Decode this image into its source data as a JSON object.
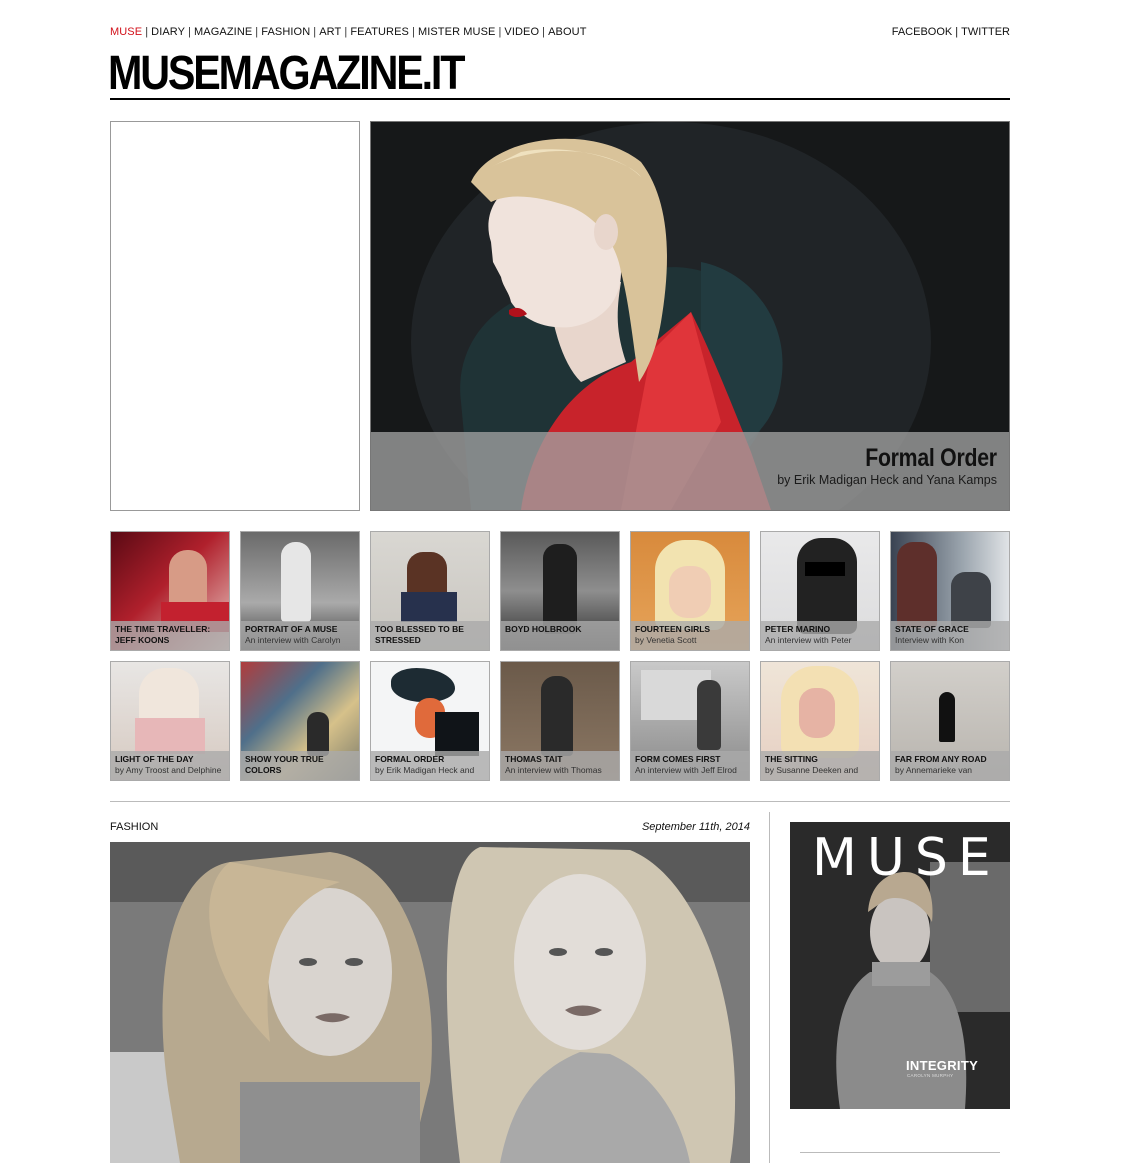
{
  "nav": {
    "items": [
      {
        "label": "MUSE",
        "active": true
      },
      {
        "label": "DIARY",
        "active": false
      },
      {
        "label": "MAGAZINE",
        "active": false
      },
      {
        "label": "FASHION",
        "active": false
      },
      {
        "label": "ART",
        "active": false
      },
      {
        "label": "FEATURES",
        "active": false
      },
      {
        "label": "MISTER MUSE",
        "active": false
      },
      {
        "label": "VIDEO",
        "active": false
      },
      {
        "label": "ABOUT",
        "active": false
      }
    ],
    "separator": "|"
  },
  "social": {
    "facebook": "FACEBOOK",
    "twitter": "TWITTER",
    "separator": "|"
  },
  "logo": "MUSEMAGAZINE.IT",
  "hero": {
    "title": "Formal Order",
    "subtitle": "by Erik Madigan Heck and Yana Kamps"
  },
  "thumbs": [
    {
      "title": "THE TIME TRAVELLER:\nJEFF KOONS",
      "subtitle": ""
    },
    {
      "title": "PORTRAIT OF A MUSE",
      "subtitle": "An interview with Carolyn"
    },
    {
      "title": "TOO BLESSED TO BE\nSTRESSED",
      "subtitle": ""
    },
    {
      "title": "BOYD HOLBROOK",
      "subtitle": ""
    },
    {
      "title": "FOURTEEN GIRLS",
      "subtitle": "by Venetia Scott"
    },
    {
      "title": "PETER MARINO",
      "subtitle": "An interview with Peter"
    },
    {
      "title": "STATE OF GRACE",
      "subtitle": "Interview with Kon"
    },
    {
      "title": "LIGHT OF THE DAY",
      "subtitle": "by Amy Troost and Delphine"
    },
    {
      "title": "SHOW YOUR TRUE\nCOLORS",
      "subtitle": ""
    },
    {
      "title": "FORMAL ORDER",
      "subtitle": "by Erik Madigan Heck and"
    },
    {
      "title": "THOMAS TAIT",
      "subtitle": "An interview with Thomas"
    },
    {
      "title": "FORM COMES FIRST",
      "subtitle": "An interview with Jeff Elrod"
    },
    {
      "title": "THE SITTING",
      "subtitle": "by Susanne Deeken and"
    },
    {
      "title": "FAR FROM ANY ROAD",
      "subtitle": "by Annemarieke van"
    }
  ],
  "post": {
    "section": "FASHION",
    "date": "September 11th, 2014"
  },
  "cover": {
    "title": "MUSE",
    "tag": "INTEGRITY",
    "sub": "CAROLYN MURPHY"
  },
  "colors": {
    "accent": "#d2101a",
    "caption_bg": "#a0a0a0",
    "hero_coat": "#d8262e"
  }
}
